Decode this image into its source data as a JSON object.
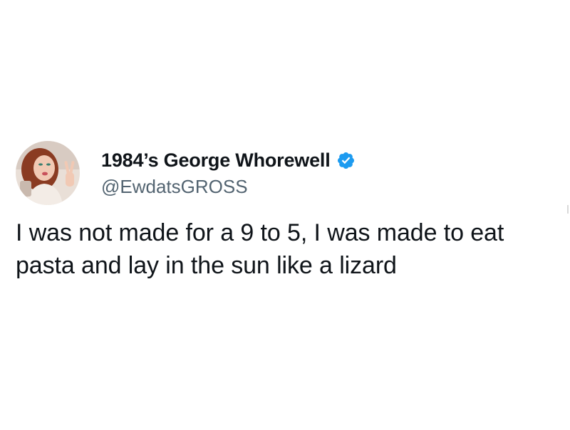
{
  "tweet": {
    "author": {
      "display_name": "1984’s George Whorewell",
      "handle": "@EwdatsGROSS",
      "verified": true,
      "verified_icon": "verified-badge-icon",
      "avatar_icon": "profile-avatar"
    },
    "text": "I was not made for a 9 to 5, I was made to eat pasta and lay in the sun like a lizard"
  },
  "colors": {
    "text_primary": "#0f1419",
    "text_secondary": "#536471",
    "verified_blue": "#1d9bf0",
    "background": "#ffffff"
  }
}
